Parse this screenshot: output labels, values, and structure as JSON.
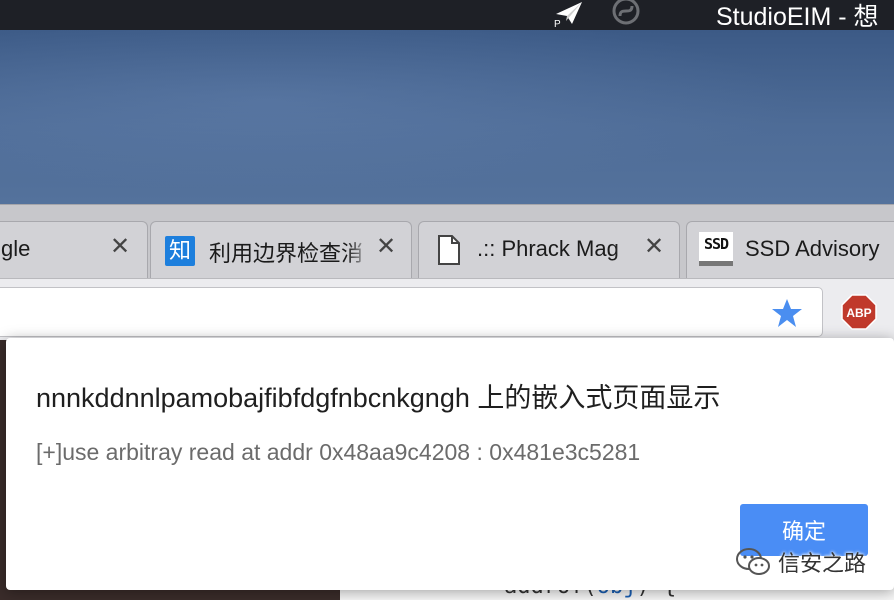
{
  "menubar": {
    "app_title": "StudioEIM - 想",
    "plane_icon_label": "P"
  },
  "tabs": [
    {
      "label": "gle",
      "icon": "none",
      "close": "✕"
    },
    {
      "label": "利用边界检查消",
      "icon": "zhihu-icon",
      "icon_text": "知",
      "close": "✕"
    },
    {
      "label": ".:: Phrack Mag",
      "icon": "document-icon",
      "close": "✕"
    },
    {
      "label": "SSD Advisory",
      "icon": "ssd-icon",
      "icon_text": "SSD",
      "close": ""
    }
  ],
  "toolbar": {
    "bookmark_icon": "star-icon",
    "adblock_label": "ABP",
    "adblock_color": "#c0392b",
    "star_color": "#4a8ef0"
  },
  "dialog": {
    "title": "nnnkddnnlpamobajfibfdgfnbcnkgngh 上的嵌入式页面显示",
    "message": "[+]use arbitray read at addr 0x48aa9c4208 : 0x481e3c5281",
    "ok_label": "确定",
    "ok_color": "#4a8df5"
  },
  "page": {
    "code_prefix": "addrof(",
    "code_highlight": "obj",
    "code_suffix": ") {"
  },
  "watermark": {
    "text": "信安之路"
  }
}
